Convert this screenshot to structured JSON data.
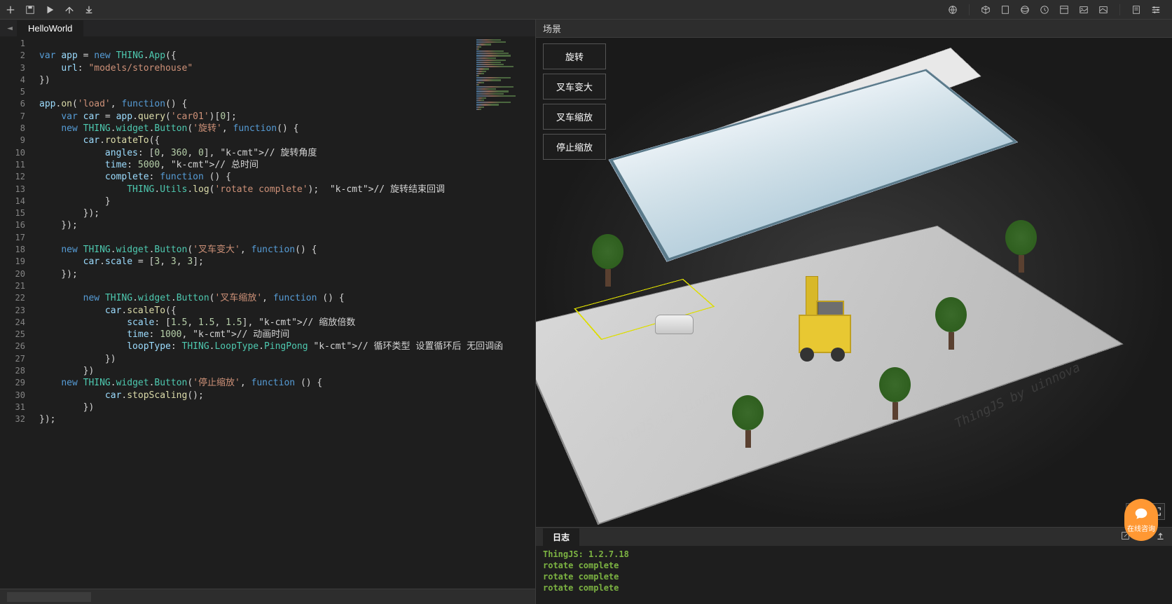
{
  "tab": {
    "name": "HelloWorld"
  },
  "scene": {
    "header": "场景",
    "buttons": [
      "旋转",
      "叉车变大",
      "叉车缩放",
      "停止缩放"
    ]
  },
  "log": {
    "header": "日志",
    "lines": [
      "ThingJS: 1.2.7.18",
      "rotate complete",
      "rotate complete",
      "rotate complete"
    ]
  },
  "chat": {
    "label": "在线咨询"
  },
  "watermarks": [
    "ThingJS by uinnova",
    "ThingJS by uinnova"
  ],
  "code": {
    "lines": [
      "",
      "var app = new THING.App({",
      "    url: \"models/storehouse\"",
      "})",
      "",
      "app.on('load', function() {",
      "    var car = app.query('car01')[0];",
      "    new THING.widget.Button('旋转', function() {",
      "        car.rotateTo({",
      "            angles: [0, 360, 0], // 旋转角度",
      "            time: 5000, // 总时间",
      "            complete: function () {",
      "                THING.Utils.log('rotate complete');  // 旋转结束回调",
      "            }",
      "        });",
      "    });",
      "",
      "    new THING.widget.Button('叉车变大', function() {",
      "        car.scale = [3, 3, 3];",
      "    });",
      "",
      "        new THING.widget.Button('叉车缩放', function () {",
      "            car.scaleTo({",
      "                scale: [1.5, 1.5, 1.5], // 缩放倍数",
      "                time: 1000, // 动画时间",
      "                loopType: THING.LoopType.PingPong // 循环类型 设置循环后 无回调函",
      "            })",
      "        })",
      "    new THING.widget.Button('停止缩放', function () {",
      "            car.stopScaling();",
      "        })",
      "});"
    ]
  }
}
